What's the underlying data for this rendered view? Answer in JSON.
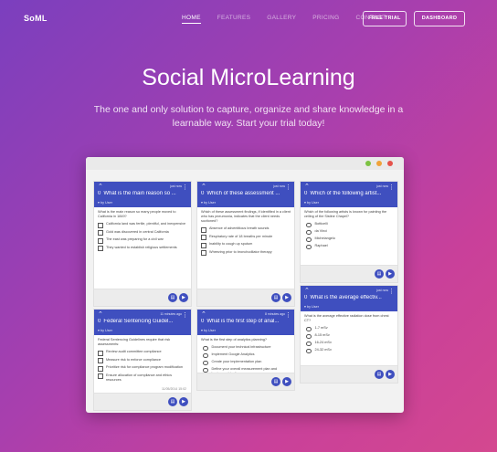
{
  "brand": "SoML",
  "nav": {
    "items": [
      {
        "label": "HOME",
        "active": true
      },
      {
        "label": "FEATURES",
        "active": false
      },
      {
        "label": "GALLERY",
        "active": false
      },
      {
        "label": "PRICING",
        "active": false
      },
      {
        "label": "CONTACT",
        "active": false
      }
    ],
    "trial_label": "FREE TRIAL",
    "dashboard_label": "DASHBOARD"
  },
  "hero": {
    "title": "Social MicroLearning",
    "subtitle": "The one and only solution to capture, organize and share knowledge in a learnable way. Start your trial today!"
  },
  "window_dots": [
    "#7cc242",
    "#f0a33a",
    "#e5534b"
  ],
  "cards": [
    {
      "time": "just now",
      "num": "0",
      "title": "What is the main reason so ...",
      "by": "by User",
      "question": "What is the main reason so many people moved to California in 1849?",
      "type": "checkbox",
      "options": [
        "California land was fertile, plentiful, and inexpensive",
        "Gold was discovered in central California",
        "The east was preparing for a civil war",
        "They wanted to establish religious settlements"
      ]
    },
    {
      "time": "just now",
      "num": "0",
      "title": "Which of these assessment ...",
      "by": "by User",
      "question": "Which of these assessment findings, if identified in a client who has pneumonia, indicates that the client needs suctioned?",
      "type": "checkbox",
      "options": [
        "Absence of adventitious breath sounds",
        "Respiratory rate of 18 breaths per minute",
        "Inability to cough up sputum",
        "Wheezing prior to bronchodilator therapy"
      ]
    },
    {
      "time": "just now",
      "num": "0",
      "title": "Which of the following artist...",
      "by": "by User",
      "question": "Which of the following artists is known for painting the ceiling of the Sistine Chapel?",
      "type": "radio",
      "options": [
        "Botticelli",
        "da Vinci",
        "Michelangelo",
        "Raphael"
      ]
    },
    {
      "time": "11 minutes ago",
      "num": "0",
      "title": "Federal Sentencing Guidel...",
      "by": "by User",
      "question": "Federal Sentencing Guidelines require that risk assessments:",
      "type": "checkbox",
      "options": [
        "Review audit committee compliance",
        "Measure risk to enforce compliance",
        "Prioritize risk for compliance program modification",
        "Ensure allocation of compliance and ethics resources"
      ],
      "date": "11/05/2014 15:02"
    },
    {
      "time": "8 minutes ago",
      "num": "0",
      "title": "What is the first step of anal...",
      "by": "by User",
      "question": "What is the first step of analytics planning?",
      "type": "radio",
      "options": [
        "Document your technical infrastructure",
        "Implement Google Analytics",
        "Create your implementation plan",
        "Define your overall measurement plan and business objectives"
      ]
    },
    {
      "time": "just now",
      "num": "0",
      "title": "What is the average effectiv...",
      "by": "by User",
      "question": "What is the average effective radiation dose from chest CT?",
      "type": "radio",
      "options": [
        "1-7 mSv",
        "8-15 mSv",
        "16-24 mSv",
        "24-32 mSv"
      ]
    }
  ]
}
